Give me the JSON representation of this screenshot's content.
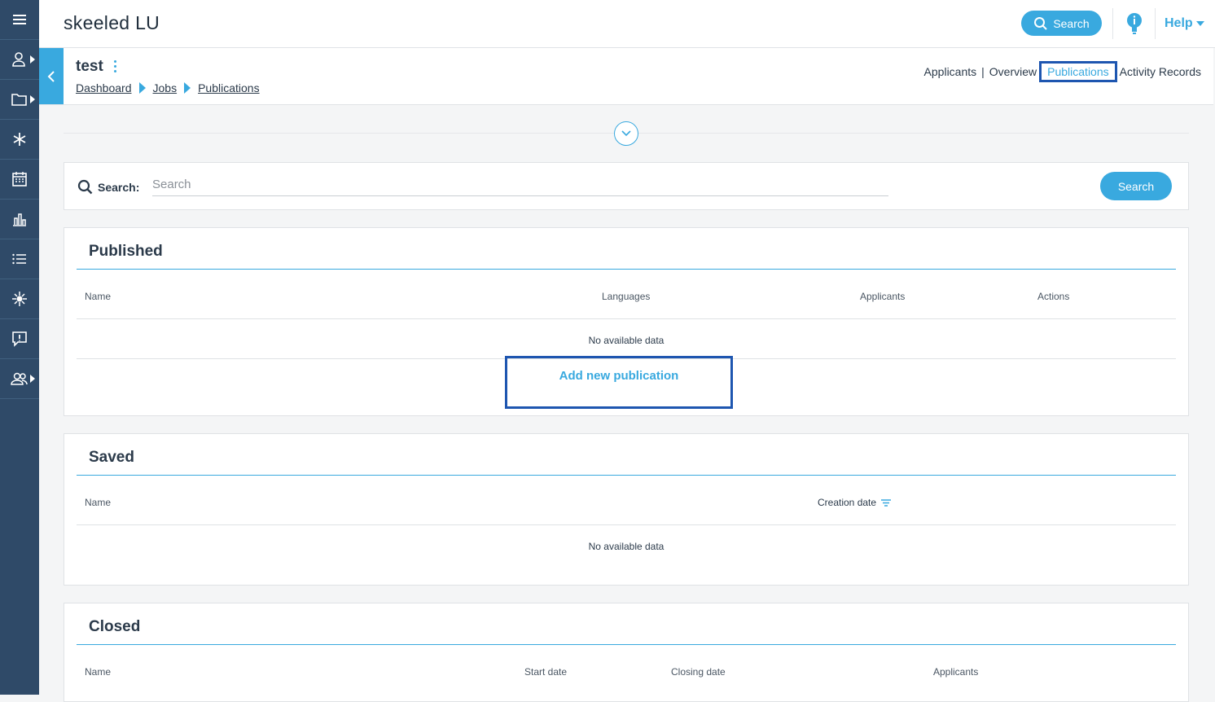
{
  "app": {
    "brand": "skeeled LU"
  },
  "topbar": {
    "search_label": "Search",
    "help_label": "Help"
  },
  "sidebar": {
    "items": [
      {
        "icon": "menu-icon"
      },
      {
        "icon": "user-icon"
      },
      {
        "icon": "folder-icon"
      },
      {
        "icon": "asterisk-icon"
      },
      {
        "icon": "calendar-icon"
      },
      {
        "icon": "bar-chart-icon"
      },
      {
        "icon": "list-icon"
      },
      {
        "icon": "network-icon"
      },
      {
        "icon": "feedback-icon"
      },
      {
        "icon": "users-group-icon"
      }
    ]
  },
  "job": {
    "title": "test",
    "breadcrumb": [
      "Dashboard",
      "Jobs",
      "Publications"
    ],
    "tabs": [
      "Applicants",
      "Overview",
      "Publications",
      "Activity Records"
    ],
    "active_tab": "Publications"
  },
  "search": {
    "label": "Search:",
    "placeholder": "Search",
    "value": "",
    "button_label": "Search"
  },
  "published": {
    "title": "Published",
    "columns": [
      "Name",
      "Languages",
      "Applicants",
      "Actions"
    ],
    "empty_text": "No available data",
    "add_label": "Add new publication"
  },
  "saved": {
    "title": "Saved",
    "columns": [
      "Name",
      "Creation date"
    ],
    "empty_text": "No available data"
  },
  "closed": {
    "title": "Closed",
    "columns": [
      "Name",
      "Start date",
      "Closing date",
      "Applicants"
    ]
  },
  "colors": {
    "accent": "#39a9df",
    "sidebar": "#2f4a68",
    "highlight": "#1e56b0"
  }
}
